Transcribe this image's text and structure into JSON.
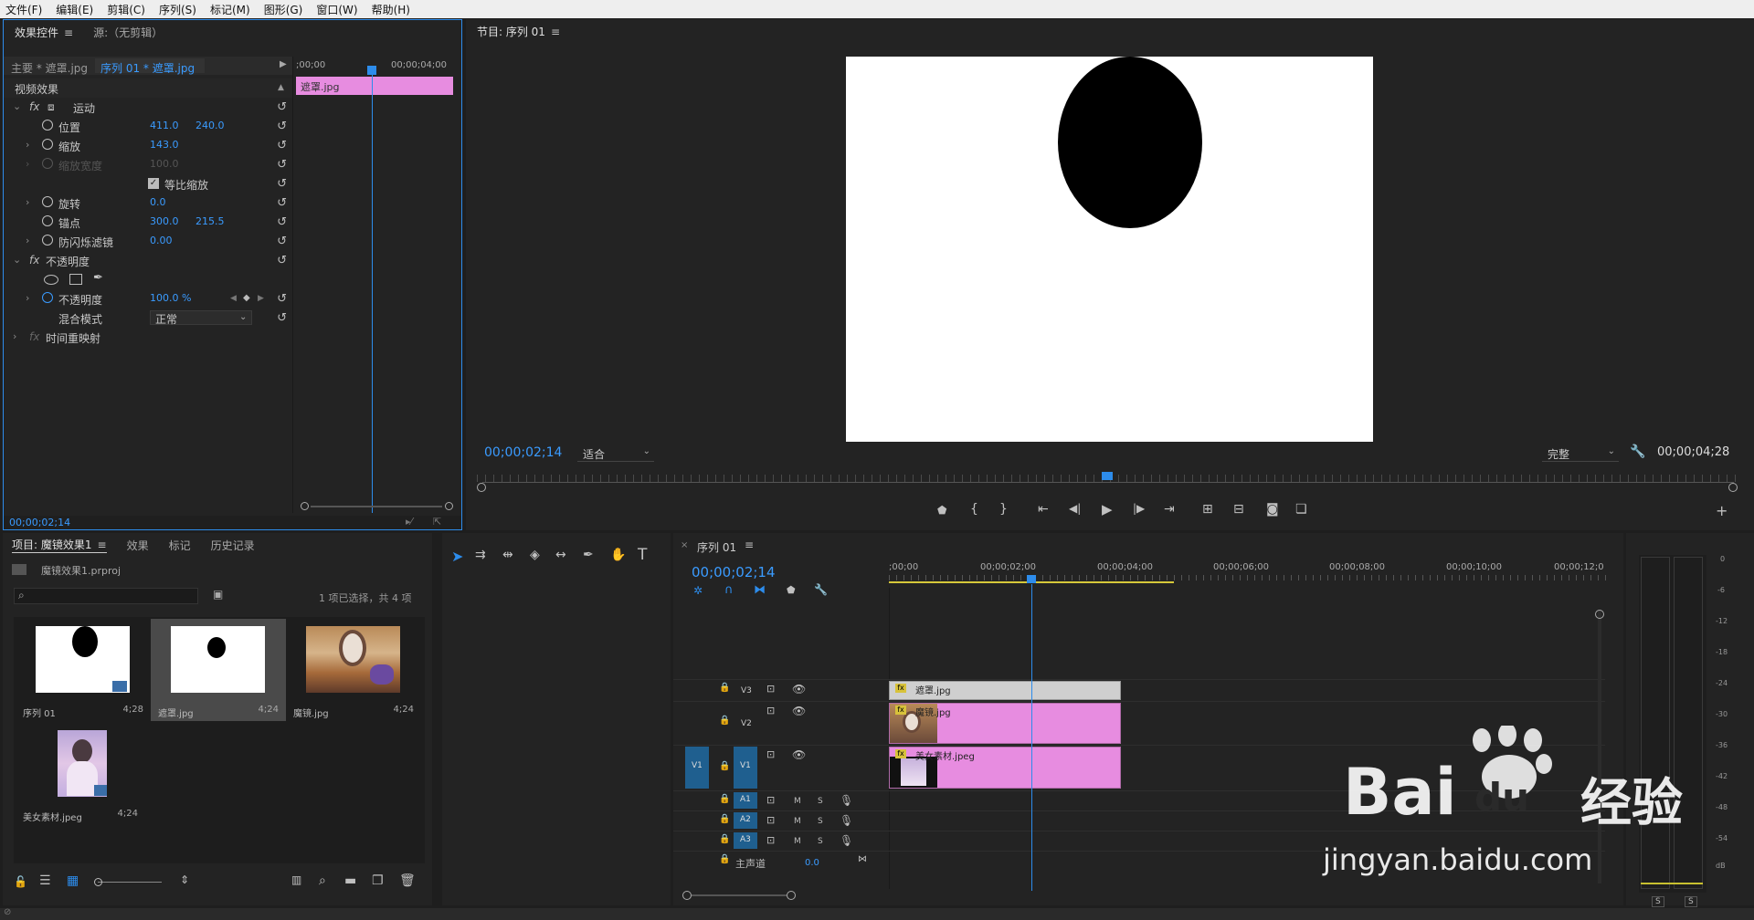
{
  "menu": [
    "文件(F)",
    "编辑(E)",
    "剪辑(C)",
    "序列(S)",
    "标记(M)",
    "图形(G)",
    "窗口(W)",
    "帮助(H)"
  ],
  "effect_controls": {
    "tab_active": "效果控件",
    "tab_source": "源:（无剪辑）",
    "master_label": "主要 * 遮罩.jpg",
    "sequence_clip": "序列 01 * 遮罩.jpg",
    "ruler_start": ";00;00",
    "ruler_end": "00;00;04;00",
    "clip_bar_label": "遮罩.jpg",
    "video_effects_label": "视频效果",
    "motion_label": "运动",
    "position_label": "位置",
    "position_x": "411.0",
    "position_y": "240.0",
    "scale_label": "缩放",
    "scale_value": "143.0",
    "scale_width_label": "缩放宽度",
    "scale_width_value": "100.0",
    "uniform_scale_label": "等比缩放",
    "rotation_label": "旋转",
    "rotation_value": "0.0",
    "anchor_label": "锚点",
    "anchor_x": "300.0",
    "anchor_y": "215.5",
    "antiflicker_label": "防闪烁滤镜",
    "antiflicker_value": "0.00",
    "opacity_group_label": "不透明度",
    "opacity_label": "不透明度",
    "opacity_value": "100.0 %",
    "blend_label": "混合模式",
    "blend_value": "正常",
    "time_remap_label": "时间重映射",
    "timecode": "00;00;02;14"
  },
  "program": {
    "title": "节目: 序列 01",
    "timecode": "00;00;02;14",
    "fit_label": "适合",
    "quality_label": "完整",
    "duration": "00;00;04;28"
  },
  "project": {
    "tabs": [
      "项目: 魔镜效果1",
      "效果",
      "标记",
      "历史记录"
    ],
    "file_name": "魔镜效果1.prproj",
    "selection_status": "1 项已选择，共 4 项",
    "items": [
      {
        "name": "序列 01",
        "duration": "4;28"
      },
      {
        "name": "遮罩.jpg",
        "duration": "4;24"
      },
      {
        "name": "魔镜.jpg",
        "duration": "4;24"
      },
      {
        "name": "美女素材.jpeg",
        "duration": "4;24"
      }
    ]
  },
  "timeline": {
    "title": "序列 01",
    "timecode": "00;00;02;14",
    "ruler": [
      ";00;00",
      "00;00;02;00",
      "00;00;04;00",
      "00;00;06;00",
      "00;00;08;00",
      "00;00;10;00",
      "00;00;12;0"
    ],
    "video_tracks": [
      "V3",
      "V2",
      "V1"
    ],
    "source_patch": "V1",
    "audio_tracks": [
      "A1",
      "A2",
      "A3"
    ],
    "master_label": "主声道",
    "master_value": "0.0",
    "mute_label": "M",
    "solo_label": "S",
    "clips": [
      {
        "track": "V3",
        "name": "遮罩.jpg"
      },
      {
        "track": "V2",
        "name": "魔镜.jpg"
      },
      {
        "track": "V1",
        "name": "美女素材.jpeg"
      }
    ]
  },
  "meter": {
    "scale": [
      "0",
      "-6",
      "-12",
      "-18",
      "-24",
      "-30",
      "-36",
      "-42",
      "-48",
      "-54",
      "dB"
    ],
    "solo_labels": [
      "S",
      "S"
    ]
  },
  "watermark": {
    "brand": "Bai",
    "du": "du",
    "cn": "经验",
    "url": "jingyan.baidu.com"
  }
}
